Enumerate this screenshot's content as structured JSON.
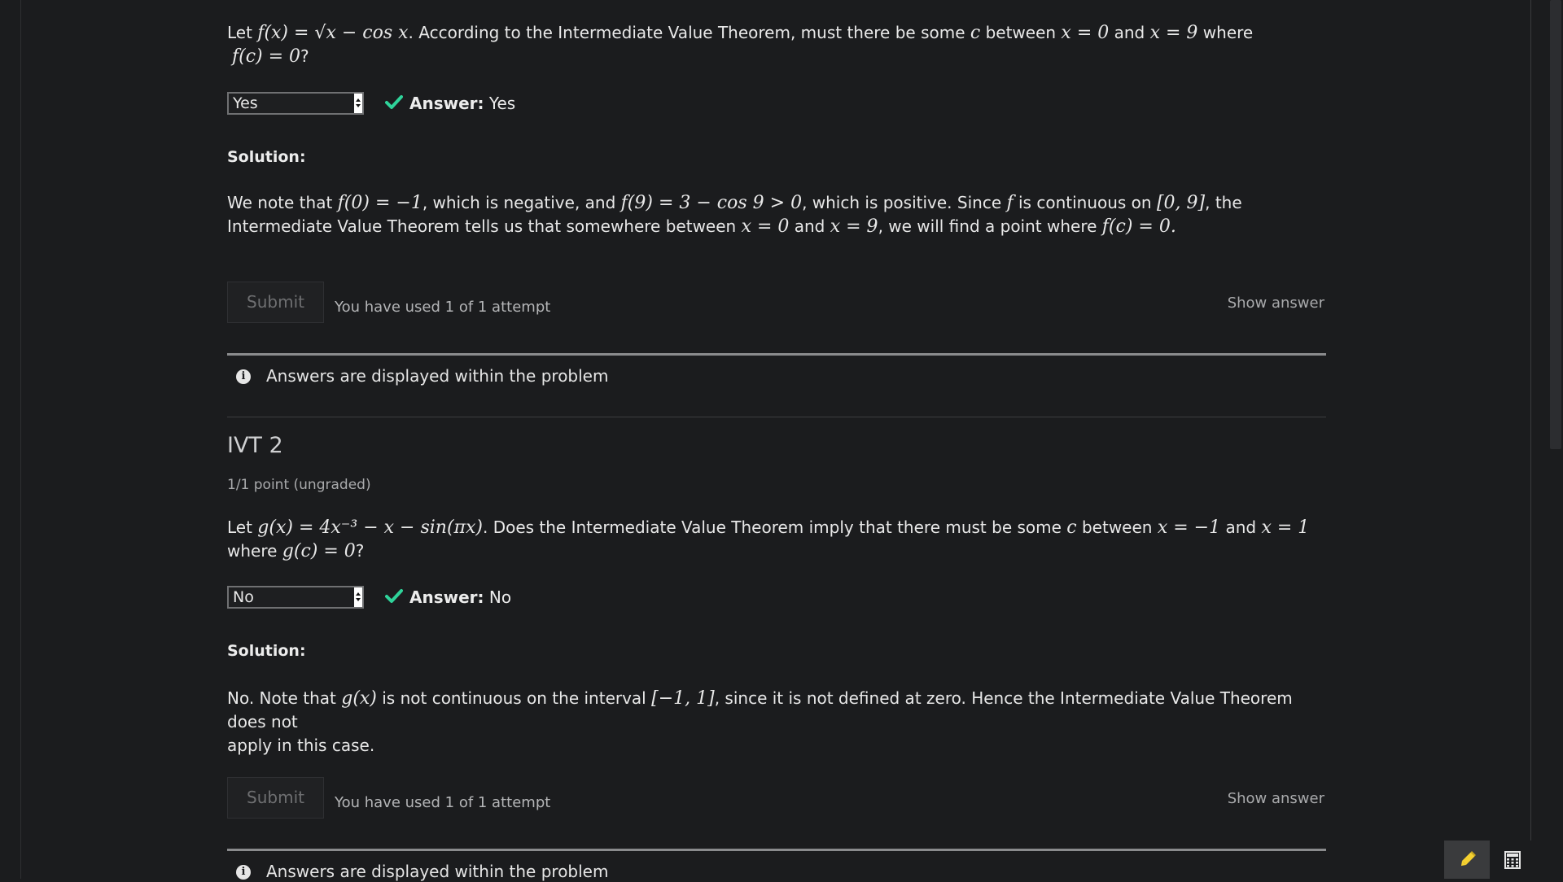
{
  "problem1": {
    "question_prefix": "Let",
    "question_math1": "f(x) = √x − cos x",
    "question_mid": ". According to the Intermediate Value Theorem, must there be some",
    "question_c": "c",
    "question_between": "between",
    "question_x0": "x = 0",
    "question_and": "and",
    "question_x9": "x = 9",
    "question_where": "where",
    "question_fc": "f(c) = 0",
    "question_end": "?",
    "selected": "Yes",
    "answer_label": "Answer:",
    "answer_value": "Yes",
    "solution_label": "Solution:",
    "solution_line1": [
      {
        "t": "We note that ",
        "m": false
      },
      {
        "t": "f(0) = −1",
        "m": true
      },
      {
        "t": ", which is negative, and ",
        "m": false
      },
      {
        "t": "f(9) = 3 − cos 9 > 0",
        "m": true
      },
      {
        "t": ", which is positive. Since ",
        "m": false
      },
      {
        "t": "f",
        "m": true
      },
      {
        "t": " is continuous on ",
        "m": false
      },
      {
        "t": "[0, 9]",
        "m": true
      },
      {
        "t": ", the",
        "m": false
      }
    ],
    "solution_line2": [
      {
        "t": "Intermediate Value Theorem tells us that somewhere between ",
        "m": false
      },
      {
        "t": "x = 0",
        "m": true
      },
      {
        "t": " and ",
        "m": false
      },
      {
        "t": "x = 9",
        "m": true
      },
      {
        "t": ", we will find a point where ",
        "m": false
      },
      {
        "t": "f(c) = 0.",
        "m": true
      }
    ],
    "submit_label": "Submit",
    "attempts_text": "You have used 1 of 1 attempt",
    "show_answer_label": "Show answer",
    "info_text": "Answers are displayed within the problem"
  },
  "problem2": {
    "title": "IVT 2",
    "points": "1/1 point (ungraded)",
    "q_line1": [
      {
        "t": "Let ",
        "m": false
      },
      {
        "t": "g(x) = 4x⁻³ − x − sin(πx)",
        "m": true
      },
      {
        "t": ". Does the Intermediate Value Theorem imply that there must be some ",
        "m": false
      },
      {
        "t": "c",
        "m": true
      },
      {
        "t": " between ",
        "m": false
      },
      {
        "t": "x = −1",
        "m": true
      },
      {
        "t": " and ",
        "m": false
      },
      {
        "t": "x = 1",
        "m": true
      }
    ],
    "q_line2": [
      {
        "t": "where ",
        "m": false
      },
      {
        "t": "g(c) = 0",
        "m": true
      },
      {
        "t": "?",
        "m": false
      }
    ],
    "selected": "No",
    "answer_label": "Answer:",
    "answer_value": "No",
    "solution_label": "Solution:",
    "solution_line1": [
      {
        "t": "No. Note that ",
        "m": false
      },
      {
        "t": "g(x)",
        "m": true
      },
      {
        "t": " is not continuous on the interval ",
        "m": false
      },
      {
        "t": "[−1, 1]",
        "m": true
      },
      {
        "t": ", since it is not defined at zero. Hence the Intermediate Value Theorem does not",
        "m": false
      }
    ],
    "solution_line2": "apply in this case.",
    "submit_label": "Submit",
    "attempts_text": "You have used 1 of 1 attempt",
    "show_answer_label": "Show answer",
    "info_text": "Answers are displayed within the problem"
  },
  "tools": {
    "pencil_icon": "pencil-icon",
    "calculator_icon": "calculator-icon"
  },
  "colors": {
    "background": "#1b1c1e",
    "check_green": "#2fd39a",
    "text": "#e8e8e8",
    "muted": "#a9aaac",
    "pencil_yellow": "#f5d130"
  }
}
